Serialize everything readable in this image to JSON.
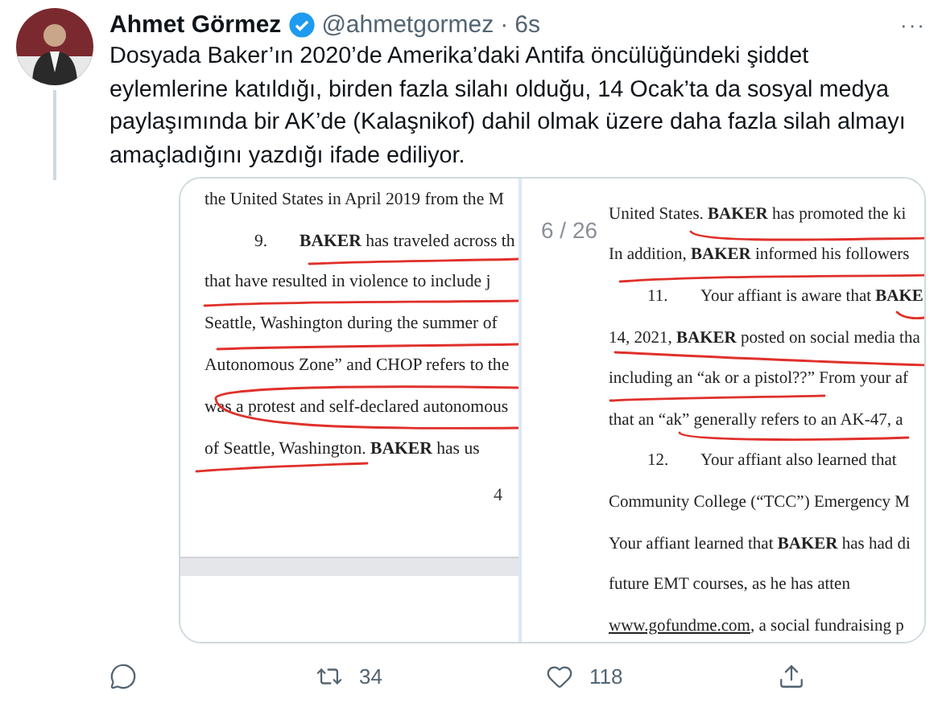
{
  "tweet": {
    "name": "Ahmet Görmez",
    "verified": true,
    "handle": "@ahmetgormez",
    "separator": "·",
    "time": "6s",
    "more": "···",
    "text": "Dosyada Baker’ın 2020’de Amerika’daki Antifa öncülüğündeki şiddet eylemlerine katıldığı, birden fazla silahı olduğu, 14 Ocak’ta da sosyal medya paylaşımında bir AK’de (Kalaşnikof) dahil olmak üzere daha fazla silah almayı amaçladığını yazdığı ifade ediliyor."
  },
  "media": {
    "pages": [
      {
        "lines": [
          {
            "text": "the United States in April 2019 from the M"
          },
          {
            "number": "9.",
            "text": "**BAKER** has traveled across th"
          },
          {
            "text": "that have resulted in violence to include j"
          },
          {
            "text": "Seattle, Washington during the summer of"
          },
          {
            "text": "Autonomous Zone” and CHOP refers to the"
          },
          {
            "text": "was a protest and self-declared autonomous"
          },
          {
            "text": "of Seattle, Washington.  **BAKER** has us"
          }
        ],
        "page_number": "4"
      },
      {
        "counter": "6 / 26",
        "lines": [
          {
            "text": "United States. **BAKER** has promoted the ki"
          },
          {
            "text": "In addition, **BAKER** informed his followers"
          },
          {
            "number": "11.",
            "text": "Your affiant is aware that **BAKE**"
          },
          {
            "text": "14, 2021, **BAKER** posted on social media tha"
          },
          {
            "text": "including an “ak or a pistol??”  From your af"
          },
          {
            "text": "that an “ak” generally refers to an AK-47, a"
          },
          {
            "number": "12.",
            "text": "Your affiant also learned that"
          },
          {
            "text": "Community College (“TCC”) Emergency M"
          },
          {
            "text": "Your affiant learned that **BAKER** has had di"
          },
          {
            "text": "future EMT courses, as he has atten"
          },
          {
            "link": "www.gofundme.com",
            "text": ", a social fundraising p"
          }
        ]
      }
    ]
  },
  "actions": [
    {
      "kind": "reply"
    },
    {
      "kind": "retweet",
      "count": "34"
    },
    {
      "kind": "like",
      "count": "118"
    },
    {
      "kind": "share"
    }
  ]
}
